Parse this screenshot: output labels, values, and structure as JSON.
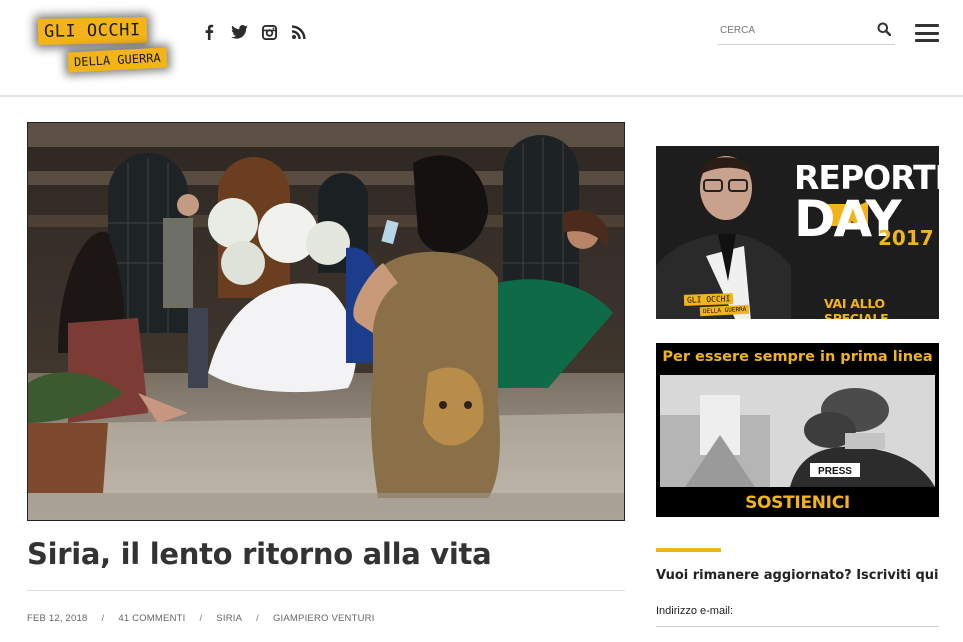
{
  "site": {
    "logo_line1": "GLI OCCHI",
    "logo_line2": "DELLA GUERRA",
    "accent_color": "#f2b418"
  },
  "header": {
    "social_icons": [
      "facebook-icon",
      "twitter-icon",
      "instagram-icon",
      "rss-icon"
    ],
    "search_placeholder": "CERCA",
    "search_icon": "search-icon",
    "menu_icon": "hamburger-menu-icon"
  },
  "article": {
    "title": "Siria, il lento ritorno alla vita",
    "meta": {
      "date": "FEB 12, 2018",
      "comments": "41 COMMENTI",
      "category": "SIRIA",
      "author": "GIAMPIERO VENTURI",
      "separator": "/"
    }
  },
  "sidebar": {
    "banner1": {
      "title_line1": "REPORTER",
      "title_line2": "DAY",
      "year": "2017",
      "cta": "VAI ALLO SPECIALE",
      "logo_line1": "GLI OCCHI",
      "logo_line2": "DELLA GUERRA"
    },
    "banner2": {
      "heading": "Per essere sempre in prima linea",
      "press_label": "PRESS",
      "cta": "SOSTIENICI"
    },
    "newsletter": {
      "title": "Vuoi rimanere aggiornato? Iscriviti qui",
      "email_label": "Indirizzo e-mail:"
    }
  }
}
